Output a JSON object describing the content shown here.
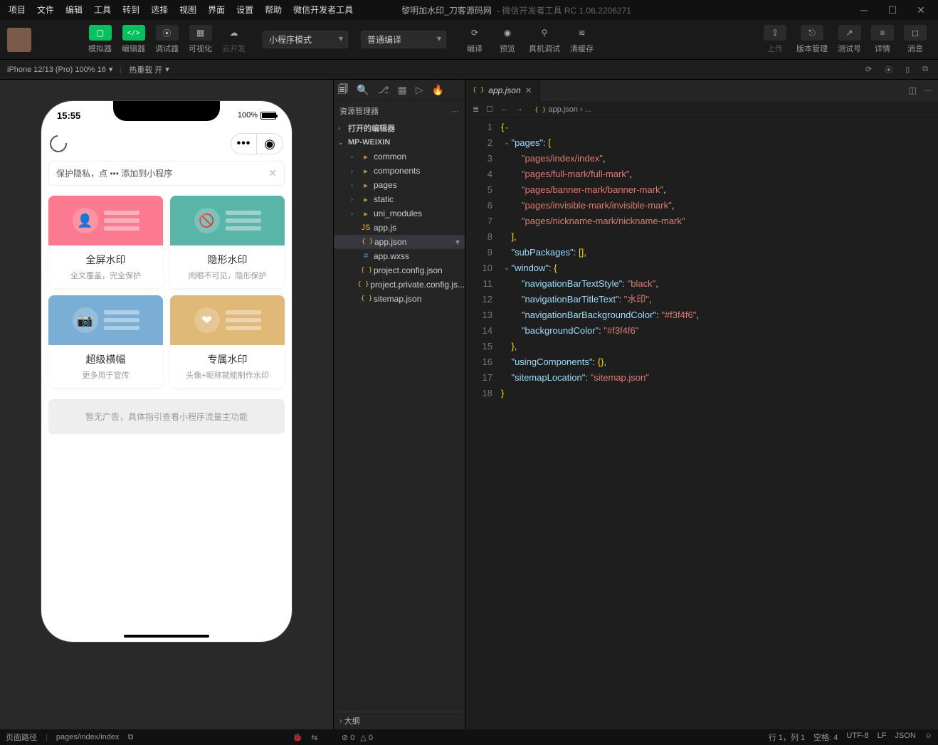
{
  "menu": {
    "items": [
      "项目",
      "文件",
      "编辑",
      "工具",
      "转到",
      "选择",
      "视图",
      "界面",
      "设置",
      "帮助",
      "微信开发者工具"
    ],
    "title": "黎明加水印_刀客源码网",
    "subtitle": " - 微信开发者工具 RC 1.06.2206271"
  },
  "toolbar": {
    "simulator": "模拟器",
    "editor": "编辑器",
    "debugger": "调试器",
    "visual": "可视化",
    "cloud": "云开发",
    "mode": "小程序模式",
    "compile_type": "普通编译",
    "compile": "编译",
    "preview": "预览",
    "remote": "真机调试",
    "clear": "清缓存",
    "upload": "上传",
    "version": "版本管理",
    "testid": "测试号",
    "detail": "详情",
    "message": "消息"
  },
  "bar2": {
    "device": "iPhone 12/13 (Pro) 100% 16",
    "scale": "",
    "hotreload": "热重载 开"
  },
  "simulator": {
    "time": "15:55",
    "battery": "100%",
    "tip": "保护隐私，点 ••• 添加到小程序",
    "cards": [
      {
        "title": "全屏水印",
        "sub": "全文覆盖，完全保护",
        "color": "pink"
      },
      {
        "title": "隐形水印",
        "sub": "肉眼不可见，隐形保护",
        "color": "teal"
      },
      {
        "title": "超级横幅",
        "sub": "更多用于宣传",
        "color": "blue"
      },
      {
        "title": "专属水印",
        "sub": "头像+昵称就能制作水印",
        "color": "gold"
      }
    ],
    "ad": "暂无广告，具体指引查看小程序流量主功能"
  },
  "explorer": {
    "header": "资源管理器",
    "sections": {
      "open": "打开的编辑器",
      "root": "MP-WEIXIN",
      "outline": "大纲"
    },
    "tree": [
      {
        "t": "folder",
        "n": "common",
        "d": 2
      },
      {
        "t": "folder",
        "n": "components",
        "d": 2
      },
      {
        "t": "folder",
        "n": "pages",
        "d": 2
      },
      {
        "t": "folder",
        "n": "static",
        "d": 2
      },
      {
        "t": "folder",
        "n": "uni_modules",
        "d": 2
      },
      {
        "t": "js",
        "n": "app.js",
        "d": 2
      },
      {
        "t": "json",
        "n": "app.json",
        "d": 2,
        "sel": true
      },
      {
        "t": "css",
        "n": "app.wxss",
        "d": 2
      },
      {
        "t": "json",
        "n": "project.config.json",
        "d": 2
      },
      {
        "t": "json",
        "n": "project.private.config.js...",
        "d": 2
      },
      {
        "t": "json",
        "n": "sitemap.json",
        "d": 2
      }
    ]
  },
  "editor": {
    "tab": "app.json",
    "crumb": "app.json",
    "crumb2": "...",
    "lines": [
      "{",
      "    \"pages\": [",
      "        \"pages/index/index\",",
      "        \"pages/full-mark/full-mark\",",
      "        \"pages/banner-mark/banner-mark\",",
      "        \"pages/invisible-mark/invisible-mark\",",
      "        \"pages/nickname-mark/nickname-mark\"",
      "    ],",
      "    \"subPackages\": [],",
      "    \"window\": {",
      "        \"navigationBarTextStyle\": \"black\",",
      "        \"navigationBarTitleText\": \"水印\",",
      "        \"navigationBarBackgroundColor\": \"#f3f4f6\",",
      "        \"backgroundColor\": \"#f3f4f6\"",
      "    },",
      "    \"usingComponents\": {},",
      "    \"sitemapLocation\": \"sitemap.json\"",
      "}"
    ]
  },
  "status": {
    "path_label": "页面路径",
    "path": "pages/index/index",
    "err": "0",
    "warn": "0",
    "pos": "行 1，列 1",
    "spaces": "空格: 4",
    "enc": "UTF-8",
    "eol": "LF",
    "lang": "JSON"
  }
}
